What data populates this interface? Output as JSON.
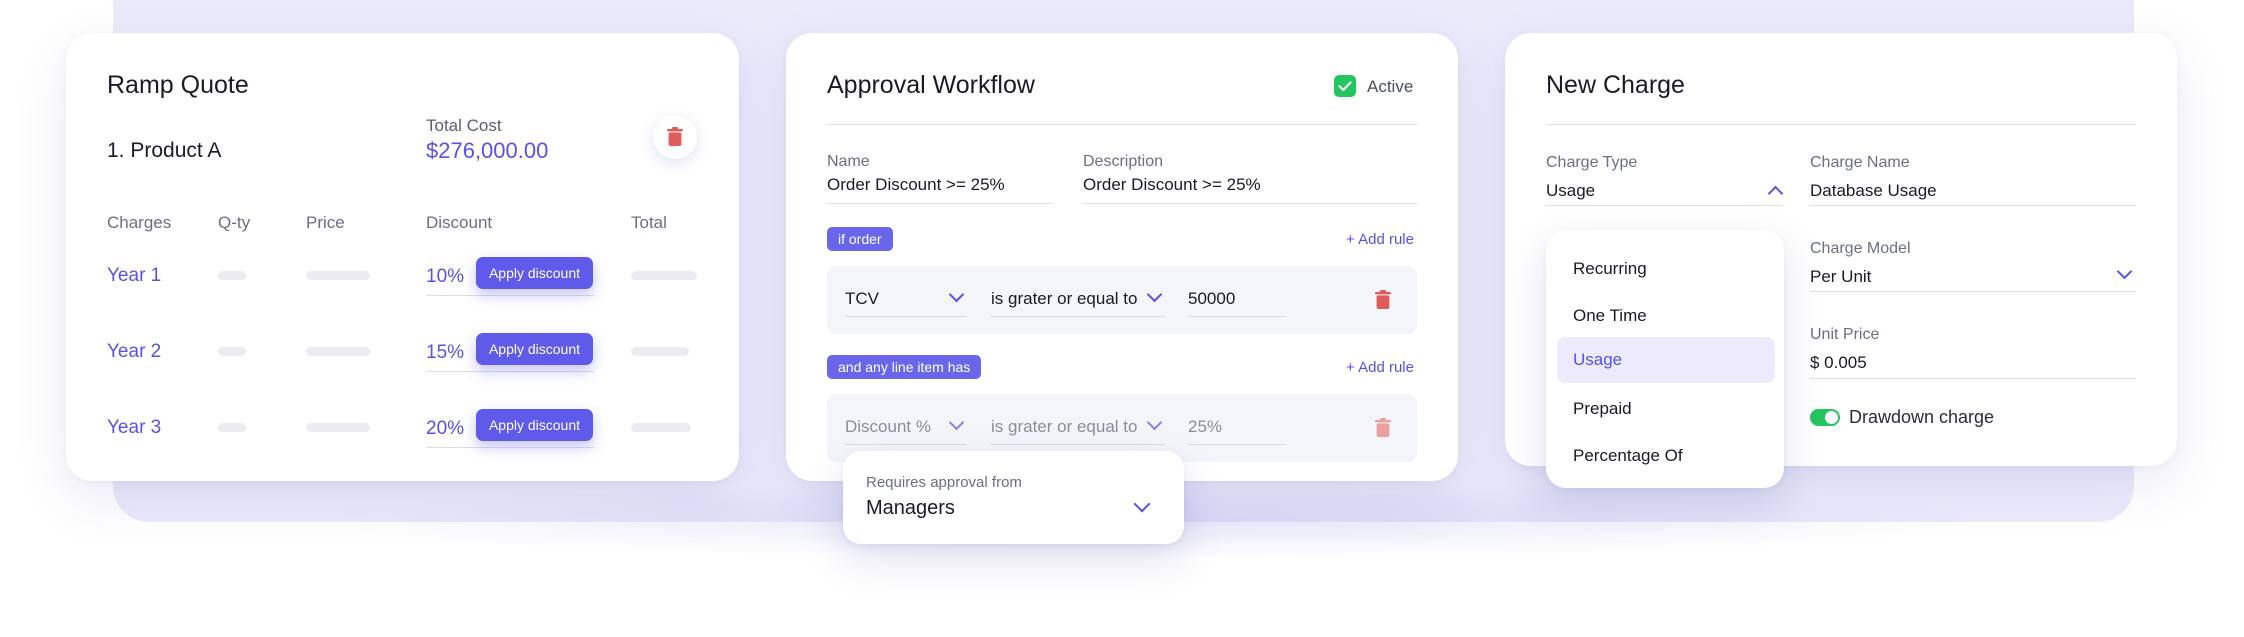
{
  "ramp_quote": {
    "title": "Ramp Quote",
    "product": "1. Product A",
    "total_cost_label": "Total Cost",
    "total_cost_value": "$276,000.00",
    "columns": [
      "Charges",
      "Q-ty",
      "Price",
      "Discount",
      "Total"
    ],
    "rows": [
      {
        "year": "Year 1",
        "discount": "10%",
        "button": "Apply discount"
      },
      {
        "year": "Year 2",
        "discount": "15%",
        "button": "Apply discount"
      },
      {
        "year": "Year 3",
        "discount": "20%",
        "button": "Apply discount"
      }
    ]
  },
  "approval_workflow": {
    "title": "Approval Workflow",
    "active_label": "Active",
    "name_label": "Name",
    "name_value": "Order Discount >= 25%",
    "description_label": "Description",
    "description_value": "Order Discount >= 25%",
    "rule1_tag": "if order",
    "rule2_tag": "and any line item has",
    "add_rule_label": "+ Add rule",
    "rule1": {
      "field": "TCV",
      "operator": "is grater or equal to",
      "value": "50000"
    },
    "rule2": {
      "field": "Discount %",
      "operator": "is grater or equal to",
      "value": "25%"
    },
    "approval_label": "Requires approval from",
    "approval_value": "Managers"
  },
  "new_charge": {
    "title": "New Charge",
    "charge_type_label": "Charge Type",
    "charge_type_value": "Usage",
    "charge_name_label": "Charge Name",
    "charge_name_value": "Database Usage",
    "charge_model_label": "Charge Model",
    "charge_model_value": "Per Unit",
    "unit_price_label": "Unit Price",
    "unit_price_value": "$ 0.005",
    "drawdown_label": "Drawdown charge",
    "options": [
      "Recurring",
      "One Time",
      "Usage",
      "Prepaid",
      "Percentage Of"
    ],
    "selected_option": "Usage"
  },
  "colors": {
    "accent": "#5751e8",
    "button": "#5f5ae9",
    "active_green": "#22c55e",
    "delete_red": "#e05b5b",
    "backdrop": "#ebeafb"
  }
}
